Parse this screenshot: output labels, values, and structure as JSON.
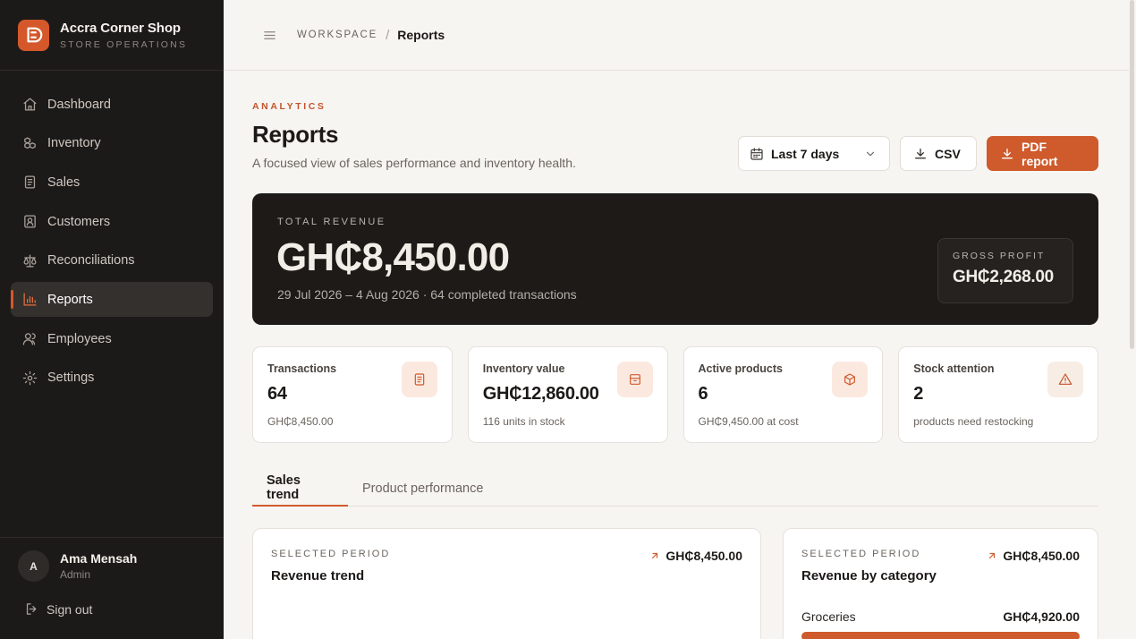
{
  "brand": {
    "name": "Accra Corner Shop",
    "subtitle": "STORE OPERATIONS"
  },
  "nav": [
    {
      "label": "Dashboard",
      "icon": "home-icon"
    },
    {
      "label": "Inventory",
      "icon": "boxes-icon"
    },
    {
      "label": "Sales",
      "icon": "receipt-icon"
    },
    {
      "label": "Customers",
      "icon": "contact-icon"
    },
    {
      "label": "Reconciliations",
      "icon": "scale-icon"
    },
    {
      "label": "Reports",
      "icon": "bar-chart-icon",
      "active": true
    },
    {
      "label": "Employees",
      "icon": "users-icon"
    },
    {
      "label": "Settings",
      "icon": "gear-icon"
    }
  ],
  "user": {
    "initial": "A",
    "name": "Ama Mensah",
    "role": "Admin"
  },
  "signout_label": "Sign out",
  "breadcrumb": {
    "root": "WORKSPACE",
    "separator": "/",
    "current": "Reports"
  },
  "header": {
    "eyebrow": "ANALYTICS",
    "title": "Reports",
    "subtitle": "A focused view of sales performance and inventory health."
  },
  "actions": {
    "range_label": "Last 7 days",
    "csv_label": "CSV",
    "pdf_label": "PDF report"
  },
  "hero": {
    "label": "TOTAL REVENUE",
    "value": "GH₵8,450.00",
    "meta": "29 Jul 2026 – 4 Aug 2026 · 64 completed transactions",
    "gross_profit_label": "GROSS PROFIT",
    "gross_profit_value": "GH₵2,268.00"
  },
  "stats": [
    {
      "label": "Transactions",
      "value": "64",
      "foot": "GH₵8,450.00",
      "icon": "receipt-icon"
    },
    {
      "label": "Inventory value",
      "value": "GH₵12,860.00",
      "foot": "116 units in stock",
      "icon": "archive-icon"
    },
    {
      "label": "Active products",
      "value": "6",
      "foot": "GH₵9,450.00 at cost",
      "icon": "package-icon"
    },
    {
      "label": "Stock attention",
      "value": "2",
      "foot": "products need restocking",
      "icon": "warning-icon"
    }
  ],
  "tabs": [
    {
      "label": "Sales trend",
      "active": true
    },
    {
      "label": "Product performance",
      "active": false
    }
  ],
  "revenue_trend": {
    "label": "SELECTED PERIOD",
    "title": "Revenue trend",
    "total": "GH₵8,450.00"
  },
  "revenue_by_category": {
    "label": "SELECTED PERIOD",
    "title": "Revenue by category",
    "total": "GH₵8,450.00",
    "categories": [
      {
        "name": "Groceries",
        "value": "GH₵4,920.00",
        "share": 1.0
      }
    ]
  },
  "colors": {
    "accent": "#cf5a2c",
    "sidebar": "#1c1a19",
    "hero": "#1d1a18",
    "page": "#f7f5f2"
  }
}
